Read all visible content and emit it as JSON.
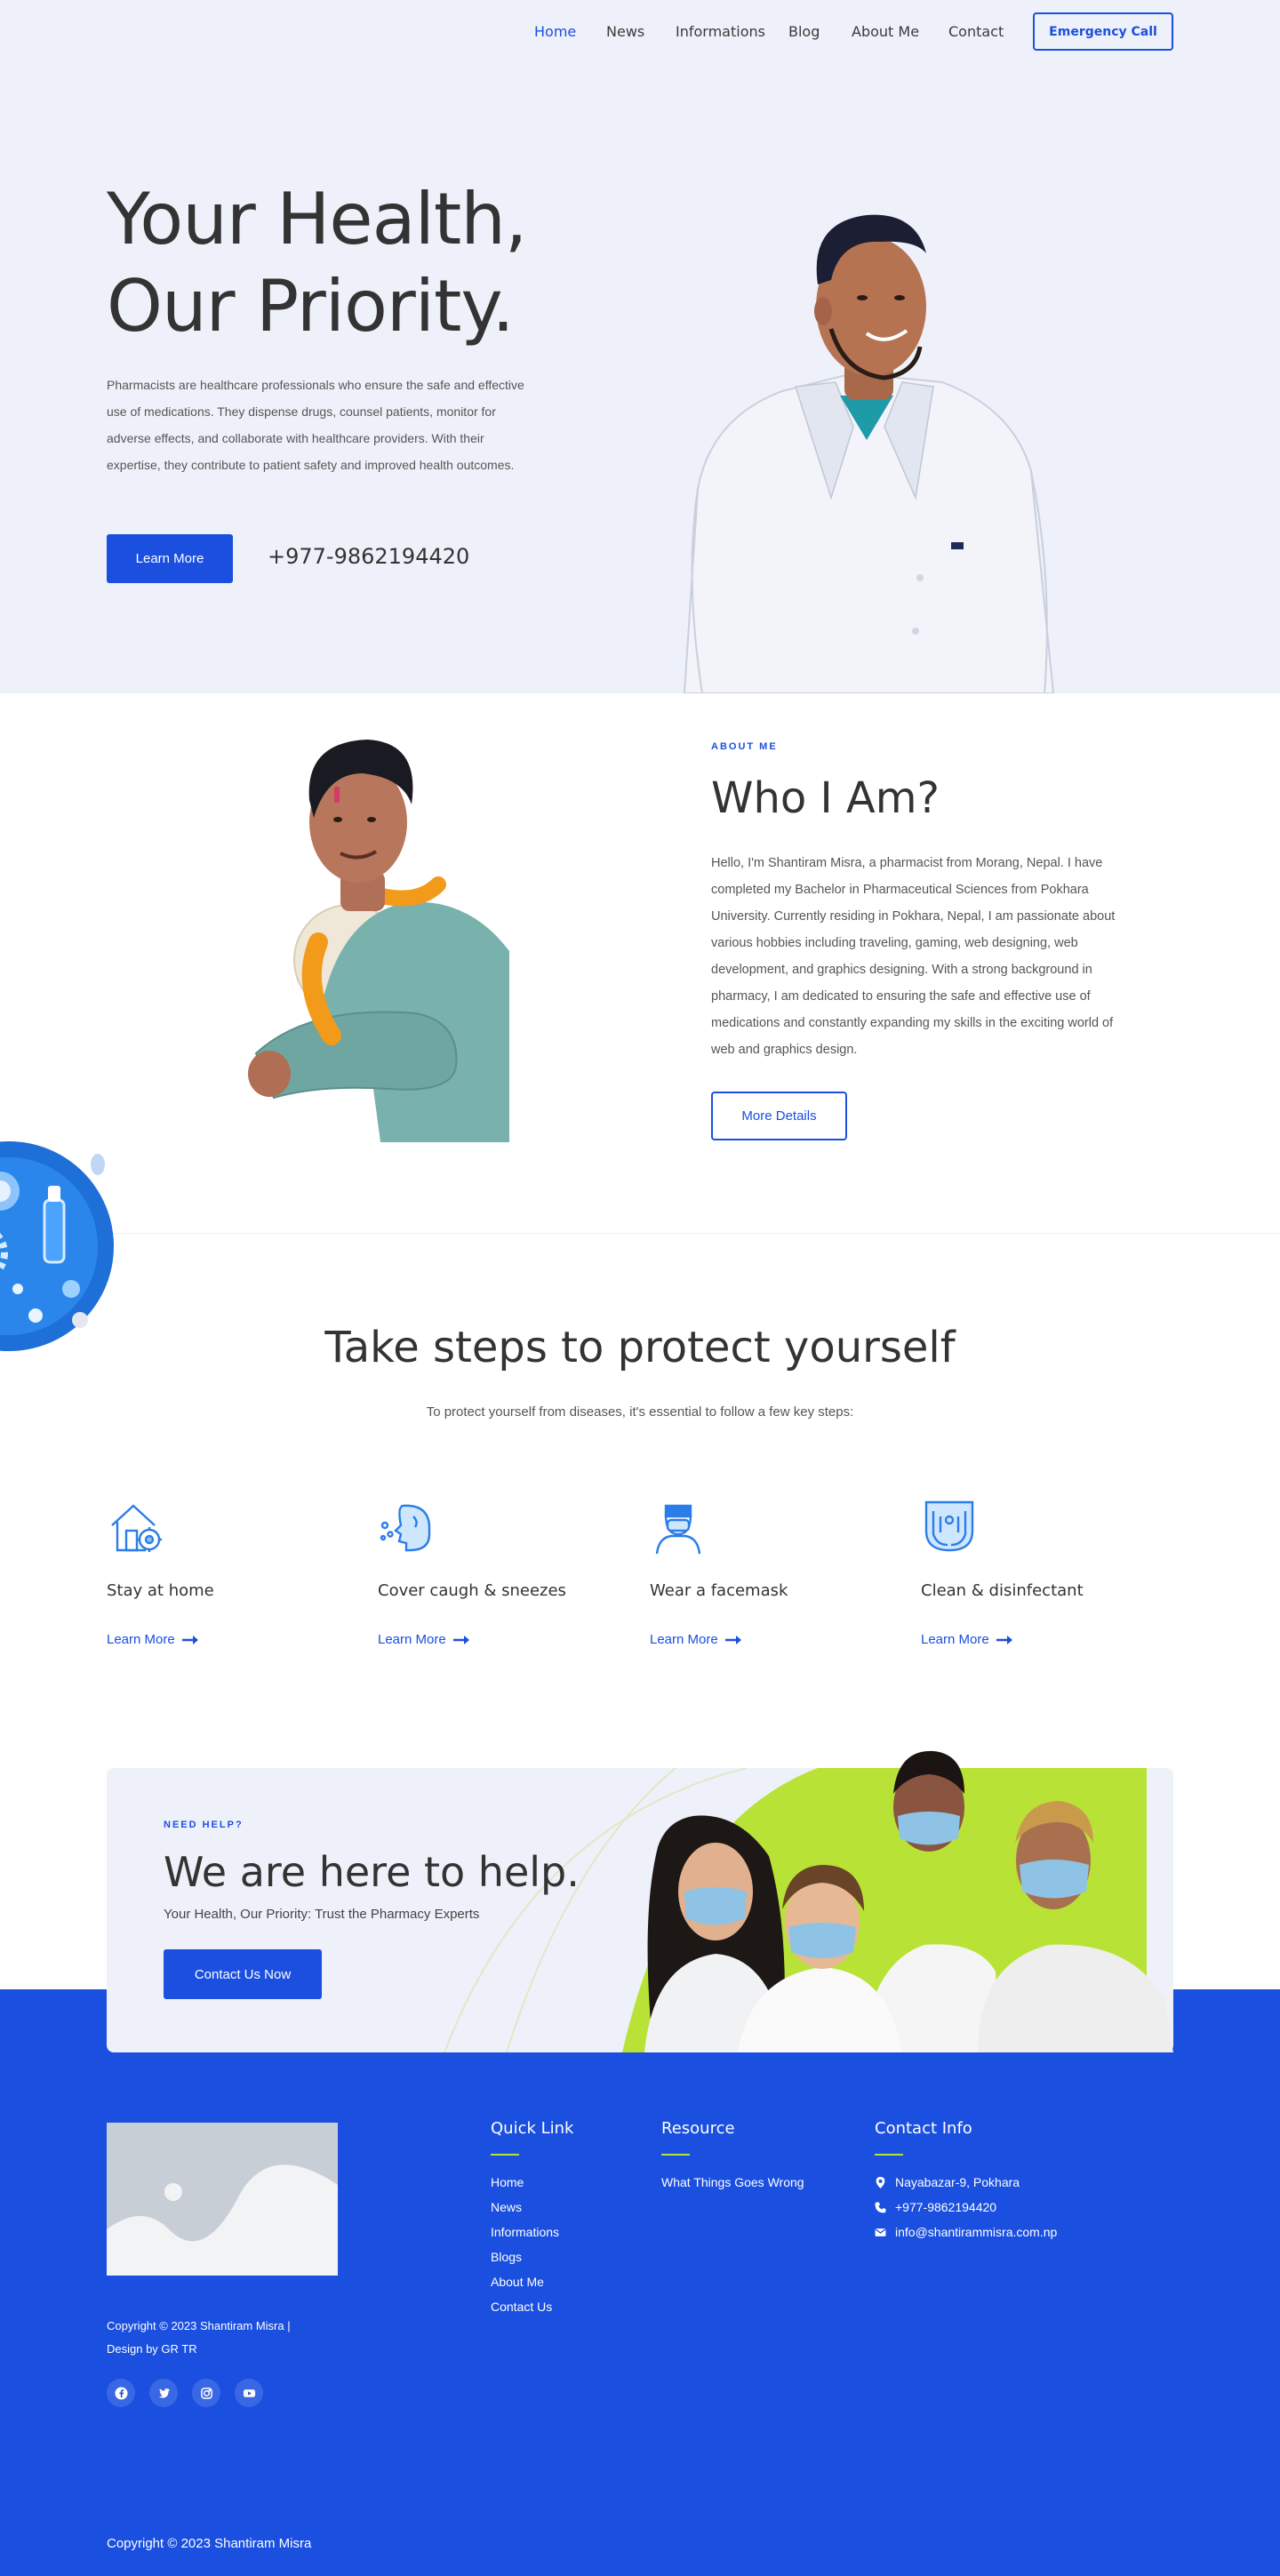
{
  "nav": {
    "items": [
      {
        "label": "Home",
        "active": true
      },
      {
        "label": "News",
        "active": false
      },
      {
        "label": "Informations",
        "active": false
      },
      {
        "label": "Blog",
        "active": false
      },
      {
        "label": "About Me",
        "active": false
      },
      {
        "label": "Contact",
        "active": false
      }
    ],
    "emergency_label": "Emergency Call"
  },
  "hero": {
    "title": "Your Health, Our Priority.",
    "description": "Pharmacists are healthcare professionals who ensure the safe and effective use of medications. They dispense drugs, counsel patients, monitor for adverse effects, and collaborate with healthcare providers. With their expertise, they contribute to patient safety and improved health outcomes.",
    "cta_label": "Learn More",
    "phone": "+977-9862194420"
  },
  "about": {
    "kicker": "ABOUT ME",
    "title": "Who I Am?",
    "description": "Hello, I'm Shantiram Misra, a pharmacist from Morang, Nepal. I have completed my Bachelor in Pharmaceutical Sciences from Pokhara University. Currently residing in Pokhara, Nepal, I am passionate about various hobbies including traveling, gaming, web designing, web development, and graphics designing. With a strong background in pharmacy, I am dedicated to ensuring the safe and effective use of medications and constantly expanding my skills in the exciting world of web and graphics design.",
    "button_label": "More Details"
  },
  "steps": {
    "title": "Take steps to protect yourself",
    "subtitle": "To protect yourself from diseases, it's essential to follow a few key steps:",
    "items": [
      {
        "title": "Stay at home",
        "link": "Learn More",
        "icon": "house-virus-icon"
      },
      {
        "title": "Cover caugh & sneezes",
        "link": "Learn More",
        "icon": "sneeze-icon"
      },
      {
        "title": "Wear a facemask",
        "link": "Learn More",
        "icon": "facemask-icon"
      },
      {
        "title": "Clean & disinfectant",
        "link": "Learn More",
        "icon": "hand-wash-icon"
      }
    ]
  },
  "help": {
    "kicker": "NEED HELP?",
    "title": "We are here to help.",
    "subtitle": "Your Health, Our Priority: Trust the Pharmacy Experts",
    "button_label": "Contact Us Now"
  },
  "footer": {
    "copyright_small": "Copyright © 2023 Shantiram Misra | Design by GR TR",
    "social": [
      "facebook-icon",
      "twitter-icon",
      "instagram-icon",
      "youtube-icon"
    ],
    "quick_link": {
      "title": "Quick Link",
      "items": [
        "Home",
        "News",
        "Informations",
        "Blogs",
        "About Me",
        "Contact Us"
      ]
    },
    "resource": {
      "title": "Resource",
      "items": [
        "What Things Goes Wrong"
      ]
    },
    "contact": {
      "title": "Contact Info",
      "address": "Nayabazar-9, Pokhara",
      "phone": "+977-9862194420",
      "email": "info@shantirammisra.com.np"
    },
    "copyright_bottom": "Copyright © 2023 Shantiram Misra"
  },
  "colors": {
    "primary": "#1a4fe0",
    "hero_bg": "#eef1f9",
    "accent_green": "#b8e336",
    "text_dark": "#333333"
  }
}
